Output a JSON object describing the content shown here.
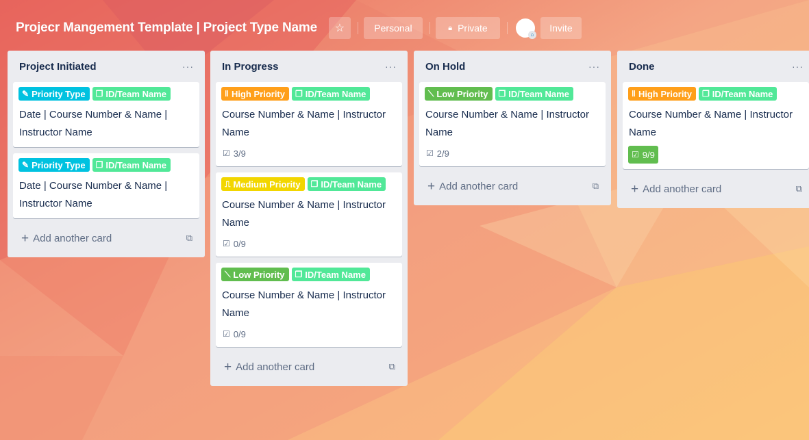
{
  "board": {
    "title": "Projecr Mangement Template | Project Type Name",
    "star_icon": "☆",
    "visibility_personal": "Personal",
    "lock_icon": "🔒︎",
    "visibility_private": "Private",
    "invite_label": "Invite"
  },
  "colors": {
    "label_blue": "#00c2e0",
    "label_green": "#51e898",
    "label_orange": "#ff9f1a",
    "label_yellow": "#f2d600",
    "label_lime": "#61bd4f",
    "complete_green": "#61bd4f"
  },
  "icons": {
    "priority_type": "✎",
    "team": "❐",
    "high": "‖",
    "medium": "⎍",
    "low": "⟍",
    "checklist": "☑",
    "plus": "+",
    "template": "⧉",
    "menu": "···"
  },
  "lists": [
    {
      "title": "Project Initiated",
      "add_card": "Add another card",
      "cards": [
        {
          "label1": "Priority Type",
          "label2": "ID/Team Name",
          "text": "Date | Course Number & Name | Instructor Name"
        },
        {
          "label1": "Priority Type",
          "label2": "ID/Team Name",
          "text": "Date | Course Number & Name | Instructor Name"
        }
      ]
    },
    {
      "title": "In Progress",
      "add_card": "Add another card",
      "cards": [
        {
          "label1": "High Priority",
          "label2": "ID/Team Name",
          "text": "Course Number & Name | Instructor Name",
          "checklist": "3/9"
        },
        {
          "label1": "Medium Priority",
          "label2": "ID/Team Name",
          "text": "Course Number & Name | Instructor Name",
          "checklist": "0/9"
        },
        {
          "label1": "Low Priority",
          "label2": "ID/Team Name",
          "text": "Course Number & Name | Instructor Name",
          "checklist": "0/9"
        }
      ]
    },
    {
      "title": "On Hold",
      "add_card": "Add another card",
      "cards": [
        {
          "label1": "Low Priority",
          "label2": "ID/Team Name",
          "text": "Course Number & Name | Instructor Name",
          "checklist": "2/9"
        }
      ]
    },
    {
      "title": "Done",
      "add_card": "Add another card",
      "cards": [
        {
          "label1": "High Priority",
          "label2": "ID/Team Name",
          "text": "Course Number & Name | Instructor Name",
          "checklist": "9/9"
        }
      ]
    }
  ]
}
